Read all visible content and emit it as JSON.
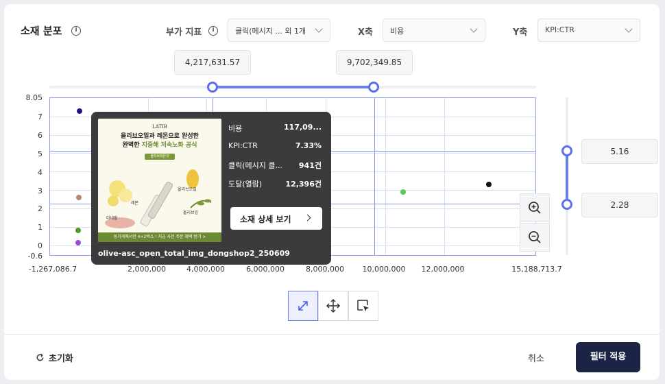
{
  "header": {
    "title": "소재 분포",
    "aux_label": "부가 지표",
    "aux_value": "클릭(메시지 ... 외 1개",
    "x_label": "X축",
    "x_value": "비용",
    "y_label": "Y축",
    "y_value": "KPI:CTR"
  },
  "range": {
    "x_min": "4,217,631.57",
    "x_max": "9,702,349.85",
    "y_max": "5.16",
    "y_min": "2.28"
  },
  "chart_data": {
    "type": "scatter",
    "x_ticks": [
      "-1,267,086.7",
      "2,000,000",
      "4,000,000",
      "6,000,000",
      "8,000,000",
      "10,000,000",
      "12,000,000",
      "15,188,713.7"
    ],
    "y_ticks": [
      "8.05",
      "7",
      "6",
      "5",
      "4",
      "3",
      "2",
      "1",
      "0",
      "-0.6"
    ],
    "xlim": [
      -1267086.7,
      15188713.7
    ],
    "ylim": [
      -0.6,
      8.05
    ],
    "points": [
      {
        "x": -250000,
        "y": 7.3,
        "color": "#2a0d8f"
      },
      {
        "x": -280000,
        "y": 2.6,
        "color": "#b08a7a"
      },
      {
        "x": -300000,
        "y": 0.8,
        "color": "#4e9a2c"
      },
      {
        "x": -290000,
        "y": 0.1,
        "color": "#9a4fd1"
      },
      {
        "x": 10700000,
        "y": 2.9,
        "color": "#5ac85a"
      },
      {
        "x": 13600000,
        "y": 3.3,
        "color": "#111111"
      }
    ]
  },
  "tooltip": {
    "rows": [
      {
        "k": "비용",
        "v": "117,09..."
      },
      {
        "k": "KPI:CTR",
        "v": "7.33%"
      },
      {
        "k": "클릭(메시지 클...",
        "v": "941건"
      },
      {
        "k": "도달(열람)",
        "v": "12,396건"
      }
    ],
    "button": "소재 상세 보기",
    "name": "olive-asc_open_total_img_dongshop2_250609",
    "thumb": {
      "brand": "LATIB",
      "line1": "올리브오일과 레몬으로 완성한",
      "line2a": "완벽한 ",
      "line2b": "지중해 저속노화 공식",
      "pill": "올리브레몬샷",
      "cap_oil": "올리브오일",
      "cap_lemon": "레몬",
      "cap_salt": "미네랄",
      "cap_olive": "올리브잎",
      "foot": "동가게에서만 4+2박스 ! 지금 사전 주문 혜택 받기 >"
    }
  },
  "footer": {
    "reset": "초기화",
    "cancel": "취소",
    "apply": "필터 적용"
  }
}
